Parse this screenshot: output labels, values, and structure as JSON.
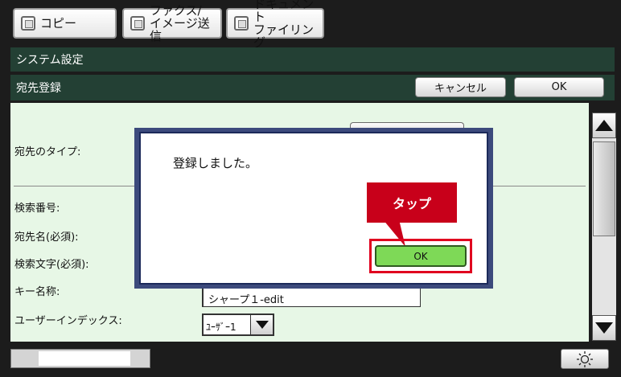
{
  "tabs": [
    {
      "label": "コピー",
      "icon": "copy-icon"
    },
    {
      "label": "ファクス/\nイメージ送信",
      "icon": "fax-icon"
    },
    {
      "label": "ドキュメント\nファイリング",
      "icon": "document-filing-icon"
    }
  ],
  "header": {
    "system_title": "システム設定",
    "section_title": "宛先登録",
    "cancel_label": "キャンセル",
    "ok_label": "OK"
  },
  "form": {
    "destination_type_label": "宛先のタイプ:",
    "search_number_label": "検索番号:",
    "destination_name_label": "宛先名(必須):",
    "search_text_label": "検索文字(必須):",
    "key_name_label": "キー名称:",
    "key_name_value": "シャープ１-edit",
    "user_index_label": "ユーザーインデックス:",
    "user_index_value": "ﾕｰｻﾞｰ1"
  },
  "dialog": {
    "message": "登録しました。",
    "ok_label": "OK",
    "callout_label": "タップ"
  },
  "colors": {
    "header_bar": "#234034",
    "panel_bg": "#e7f7e6",
    "modal_ok": "#7ed957",
    "callout": "#c8001a"
  }
}
